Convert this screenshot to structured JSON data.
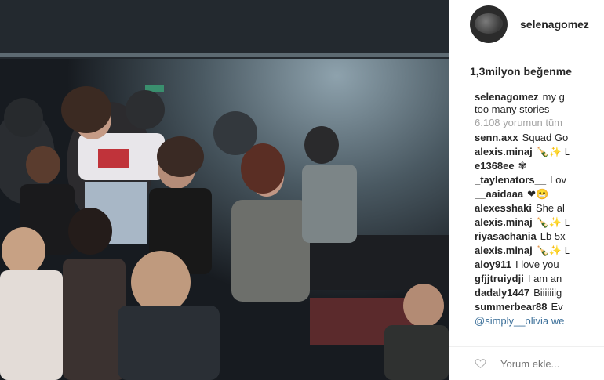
{
  "post": {
    "username": "selenagomez",
    "likes": "1,3milyon beğenme",
    "caption_user": "selenagomez",
    "caption_line1": "my g",
    "caption_line2": "too many stories",
    "view_all": "6.108 yorumun tüm",
    "comments": [
      {
        "user": "senn.axx",
        "text": "Squad Go"
      },
      {
        "user": "alexis.minaj",
        "text": "🍾✨ L"
      },
      {
        "user": "e1368ee",
        "text": "✾"
      },
      {
        "user": "_taylenators__",
        "text": "Lov"
      },
      {
        "user": "__aaidaaa",
        "text": "❤😁"
      },
      {
        "user": "alexesshaki",
        "text": "She al"
      },
      {
        "user": "alexis.minaj",
        "text": "🍾✨ L"
      },
      {
        "user": "riyasachania",
        "text": "Lb 5x"
      },
      {
        "user": "alexis.minaj",
        "text": "🍾✨ L"
      },
      {
        "user": "aloy911",
        "text": "I love you"
      },
      {
        "user": "gfjjtruiydji",
        "text": "I am an"
      },
      {
        "user": "dadaly1447",
        "text": "Biiiiiiig"
      },
      {
        "user": "summerbear88",
        "text": "Ev"
      },
      {
        "user": "",
        "text": "@simply__olivia we"
      }
    ],
    "comment_placeholder": "Yorum ekle..."
  },
  "icons": {
    "heart": "heart-icon"
  },
  "colors": {
    "link": "#3f729b",
    "muted": "#a3a3a3"
  }
}
